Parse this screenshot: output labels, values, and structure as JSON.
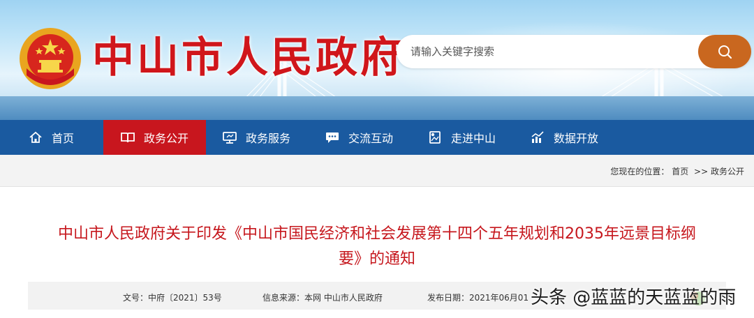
{
  "header": {
    "site_title": "中山市人民政府",
    "search_placeholder": "请输入关键字搜索"
  },
  "nav": {
    "items": [
      {
        "label": "首页",
        "icon": "home-icon"
      },
      {
        "label": "政务公开",
        "icon": "book-icon",
        "active": true
      },
      {
        "label": "政务服务",
        "icon": "monitor-icon"
      },
      {
        "label": "交流互动",
        "icon": "chat-icon"
      },
      {
        "label": "走进中山",
        "icon": "photo-icon"
      },
      {
        "label": "数据开放",
        "icon": "bar-chart-icon"
      }
    ]
  },
  "breadcrumb": {
    "prefix": "您现在的位置：",
    "home": "首页",
    "separator": ">>",
    "current": "政务公开"
  },
  "article": {
    "title_line1": "中山市人民政府关于印发《中山市国民经济和社会发展第十四个五年规划和2035年远景目标纲",
    "title_line2": "要》的通知",
    "doc_no": "文号：中府〔2021〕53号",
    "source": "信息来源：本网 中山市人民政府",
    "date": "发布日期：2021年06月01"
  },
  "watermark": {
    "text": "头条 @蓝蓝的天蓝蓝的雨"
  },
  "colors": {
    "brand_red": "#d0161b",
    "nav_blue": "#1a5aa0",
    "nav_active": "#c8161e",
    "search_button": "#c9671f"
  }
}
